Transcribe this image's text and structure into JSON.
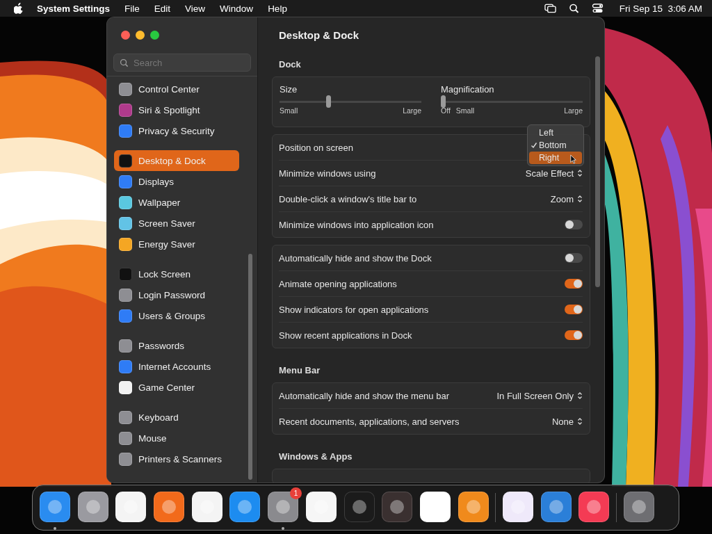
{
  "menu_bar": {
    "app_name": "System Settings",
    "menus": [
      "File",
      "Edit",
      "View",
      "Window",
      "Help"
    ],
    "clock": "Fri Sep 15  3:06 AM"
  },
  "window": {
    "sidebar": {
      "search": {
        "placeholder": "Search"
      },
      "groups": [
        [
          {
            "label": "Control Center",
            "color": "#8e8e93",
            "selected": false
          },
          {
            "label": "Siri & Spotlight",
            "color": "#b03a8c",
            "selected": false
          },
          {
            "label": "Privacy & Security",
            "color": "#2f7cf6",
            "selected": false
          }
        ],
        [
          {
            "label": "Desktop & Dock",
            "color": "#111111",
            "selected": true
          },
          {
            "label": "Displays",
            "color": "#2f7cf6",
            "selected": false
          },
          {
            "label": "Wallpaper",
            "color": "#5ac8e0",
            "selected": false
          },
          {
            "label": "Screen Saver",
            "color": "#62c3e6",
            "selected": false
          },
          {
            "label": "Energy Saver",
            "color": "#f5a623",
            "selected": false
          }
        ],
        [
          {
            "label": "Lock Screen",
            "color": "#111111",
            "selected": false
          },
          {
            "label": "Login Password",
            "color": "#8e8e93",
            "selected": false
          },
          {
            "label": "Users & Groups",
            "color": "#2f7cf6",
            "selected": false
          }
        ],
        [
          {
            "label": "Passwords",
            "color": "#8e8e93",
            "selected": false
          },
          {
            "label": "Internet Accounts",
            "color": "#2f7cf6",
            "selected": false
          },
          {
            "label": "Game Center",
            "color": "#f2f2f2",
            "selected": false
          }
        ],
        [
          {
            "label": "Keyboard",
            "color": "#8e8e93",
            "selected": false
          },
          {
            "label": "Mouse",
            "color": "#8e8e93",
            "selected": false
          },
          {
            "label": "Printers & Scanners",
            "color": "#8e8e93",
            "selected": false
          }
        ]
      ]
    },
    "title": "Desktop & Dock",
    "sections": [
      {
        "heading": "Dock",
        "cards": [
          {
            "kind": "sliders",
            "sliders": [
              {
                "label": "Size",
                "level": 0.34,
                "ticks": [
                  "Small",
                  "Large"
                ]
              },
              {
                "label": "Magnification",
                "level": 0,
                "ticks": [
                  "Off",
                  "Small",
                  "Large"
                ]
              }
            ]
          },
          {
            "kind": "rows",
            "rows": [
              {
                "kind": "popup",
                "label": "Position on screen",
                "menu": [
                  {
                    "label": "Left",
                    "checked": false,
                    "selected": false
                  },
                  {
                    "label": "Bottom",
                    "checked": true,
                    "selected": false
                  },
                  {
                    "label": "Right",
                    "checked": false,
                    "selected": true
                  }
                ]
              },
              {
                "kind": "popup",
                "label": "Minimize windows using",
                "value": "Scale Effect"
              },
              {
                "kind": "popup",
                "label": "Double-click a window's title bar to",
                "value": "Zoom"
              },
              {
                "kind": "toggle",
                "label": "Minimize windows into application icon",
                "on": false
              }
            ]
          },
          {
            "kind": "rows",
            "rows": [
              {
                "kind": "toggle",
                "label": "Automatically hide and show the Dock",
                "on": false
              },
              {
                "kind": "toggle",
                "label": "Animate opening applications",
                "on": true
              },
              {
                "kind": "toggle",
                "label": "Show indicators for open applications",
                "on": true
              },
              {
                "kind": "toggle",
                "label": "Show recent applications in Dock",
                "on": true
              }
            ]
          }
        ]
      },
      {
        "heading": "Menu Bar",
        "cards": [
          {
            "kind": "rows",
            "rows": [
              {
                "kind": "popup",
                "label": "Automatically hide and show the menu bar",
                "value": "In Full Screen Only"
              },
              {
                "kind": "popup",
                "label": "Recent documents, applications, and servers",
                "value": "None"
              }
            ]
          }
        ]
      },
      {
        "heading": "Windows & Apps",
        "cards": [
          {
            "kind": "partial"
          }
        ]
      }
    ]
  },
  "dock": [
    {
      "kind": "app",
      "color": "#2a8cf0",
      "running": true
    },
    {
      "kind": "app",
      "color": "#9a9aa0",
      "running": false
    },
    {
      "kind": "app",
      "color": "#f4f4f4",
      "running": false
    },
    {
      "kind": "app",
      "color": "#f26a1b",
      "running": false
    },
    {
      "kind": "app",
      "color": "#f4f4f4",
      "running": false
    },
    {
      "kind": "app",
      "color": "#1d8cf0",
      "running": false
    },
    {
      "kind": "app",
      "color": "#8a8a8e",
      "running": true,
      "badge": "1"
    },
    {
      "kind": "app",
      "color": "#f6f6f6",
      "running": false
    },
    {
      "kind": "app",
      "color": "#1b1b1b",
      "running": false
    },
    {
      "kind": "app",
      "color": "#3a3030",
      "running": false
    },
    {
      "kind": "app",
      "color": "#ffffff",
      "running": false
    },
    {
      "kind": "app",
      "color": "#f08a1c",
      "running": false
    },
    {
      "kind": "separator"
    },
    {
      "kind": "app",
      "color": "#efe9fa",
      "running": false
    },
    {
      "kind": "app",
      "color": "#2b7fd8",
      "running": false
    },
    {
      "kind": "app",
      "color": "#f43b54",
      "running": false
    },
    {
      "kind": "separator"
    },
    {
      "kind": "app",
      "color": "#6e6e72",
      "running": false
    }
  ]
}
